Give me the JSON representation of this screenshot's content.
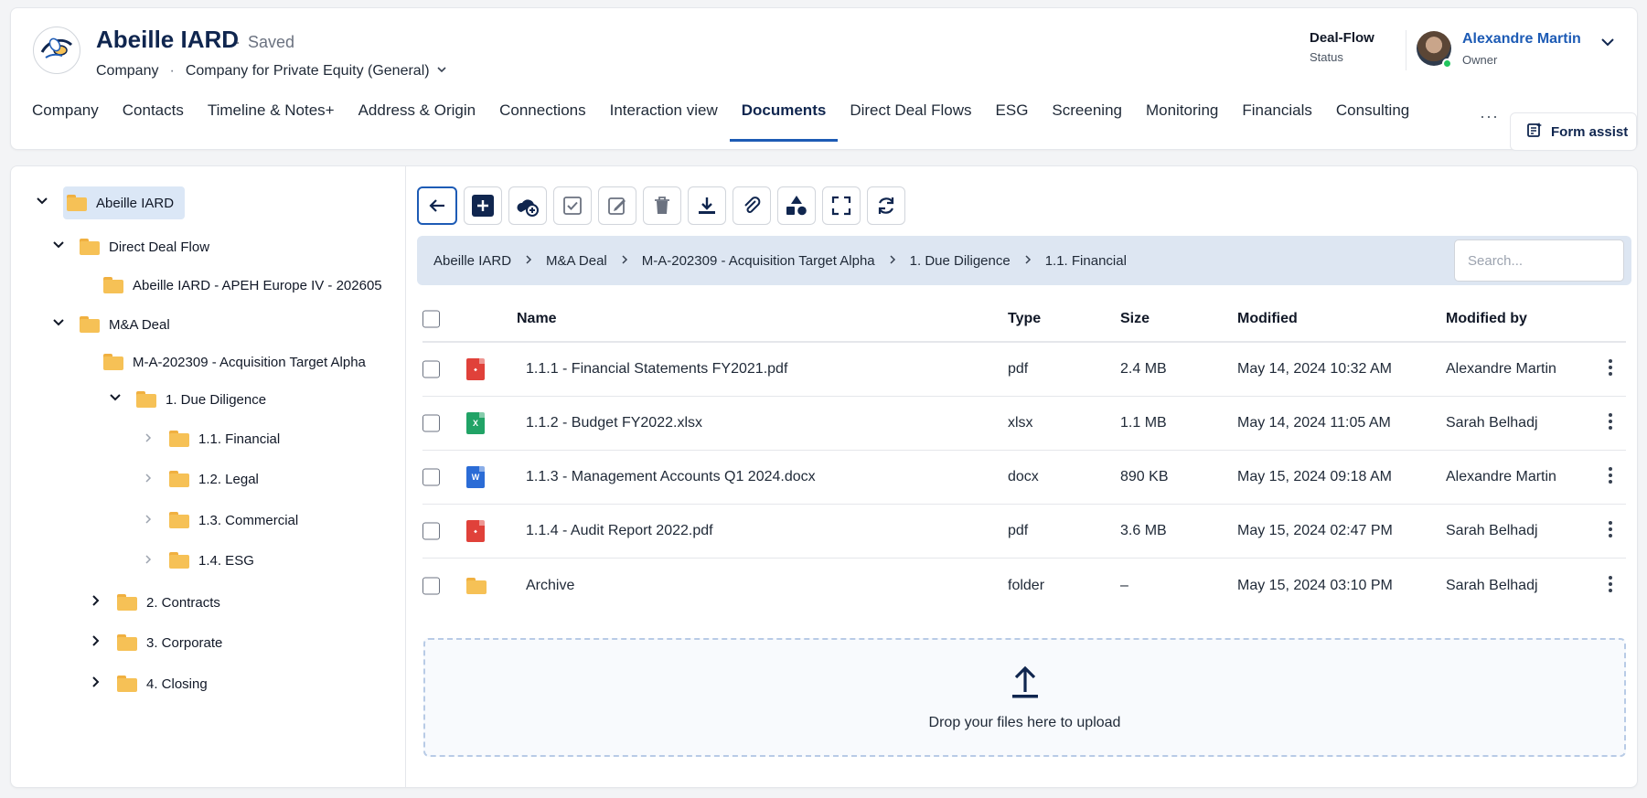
{
  "header": {
    "title": "Abeille IARD",
    "saved_dot": "·",
    "saved": "Saved",
    "entity_type": "Company",
    "sub_sep": "·",
    "template": "Company for Private Equity (General)",
    "status_value": "Deal-Flow",
    "status_label": "Status",
    "owner_name": "Alexandre Martin",
    "owner_label": "Owner"
  },
  "tabs": [
    "Company",
    "Contacts",
    "Timeline & Notes+",
    "Address & Origin",
    "Connections",
    "Interaction view",
    "Documents",
    "Direct Deal Flows",
    "ESG",
    "Screening",
    "Monitoring",
    "Financials",
    "Consulting"
  ],
  "active_tab": "Documents",
  "tabs_more": "···",
  "form_assist": "Form assist",
  "tree": {
    "root": "Abeille IARD",
    "direct_deal_flow": "Direct Deal Flow",
    "direct_item": "Abeille IARD - APEH Europe IV - 202605",
    "ma_deal": "M&A Deal",
    "ma_item": "M-A-202309 - Acquisition Target Alpha",
    "due_diligence": "1. Due Diligence",
    "financial": "1.1. Financial",
    "legal": "1.2. Legal",
    "commercial": "1.3. Commercial",
    "esg": "1.4. ESG",
    "contracts": "2. Contracts",
    "corporate": "3. Corporate",
    "closing": "4. Closing"
  },
  "breadcrumb": [
    "Abeille IARD",
    "M&A Deal",
    "M-A-202309 - Acquisition Target Alpha",
    "1. Due Diligence",
    "1.1. Financial"
  ],
  "search": {
    "placeholder": "Search..."
  },
  "table": {
    "headers": {
      "name": "Name",
      "type": "Type",
      "size": "Size",
      "modified": "Modified",
      "modified_by": "Modified by"
    },
    "rows": [
      {
        "icon": "pdf-icon",
        "name": "1.1.1 - Financial Statements FY2021.pdf",
        "type": "pdf",
        "size": "2.4 MB",
        "modified": "May 14, 2024 10:32 AM",
        "by": "Alexandre Martin"
      },
      {
        "icon": "excel-icon",
        "name": "1.1.2 - Budget FY2022.xlsx",
        "type": "xlsx",
        "size": "1.1 MB",
        "modified": "May 14, 2024 11:05 AM",
        "by": "Sarah Belhadj"
      },
      {
        "icon": "word-icon",
        "name": "1.1.3 - Management Accounts Q1 2024.docx",
        "type": "docx",
        "size": "890 KB",
        "modified": "May 15, 2024 09:18 AM",
        "by": "Alexandre Martin"
      },
      {
        "icon": "pdf-icon",
        "name": "1.1.4 - Audit Report 2022.pdf",
        "type": "pdf",
        "size": "3.6 MB",
        "modified": "May 15, 2024 02:47 PM",
        "by": "Sarah Belhadj"
      },
      {
        "icon": "folder-icon",
        "name": "Archive",
        "type": "folder",
        "size": "–",
        "modified": "May 15, 2024 03:10 PM",
        "by": "Sarah Belhadj"
      }
    ]
  },
  "dropzone": {
    "text": "Drop your files here to upload"
  },
  "colors": {
    "accent": "#1d5bb5",
    "navy": "#10264f",
    "folder": "#f6c156",
    "breadcrumb_bg": "#dde6f2",
    "online": "#22c55e"
  }
}
